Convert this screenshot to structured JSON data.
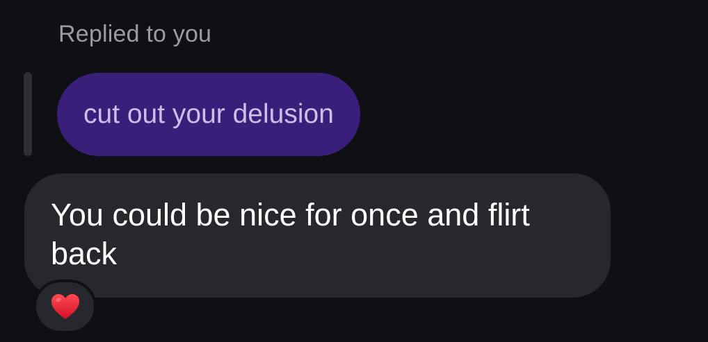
{
  "reply_header": {
    "label": "Replied to you"
  },
  "replied_message": {
    "text": "cut out your delusion",
    "bubble_color": "#3a1f7a"
  },
  "message": {
    "text": "You could be nice for once and flirt back",
    "bubble_color": "#26282d"
  },
  "reaction": {
    "icon": "heart-icon",
    "color": "#e0142c"
  },
  "theme": {
    "background": "#0f1014"
  }
}
